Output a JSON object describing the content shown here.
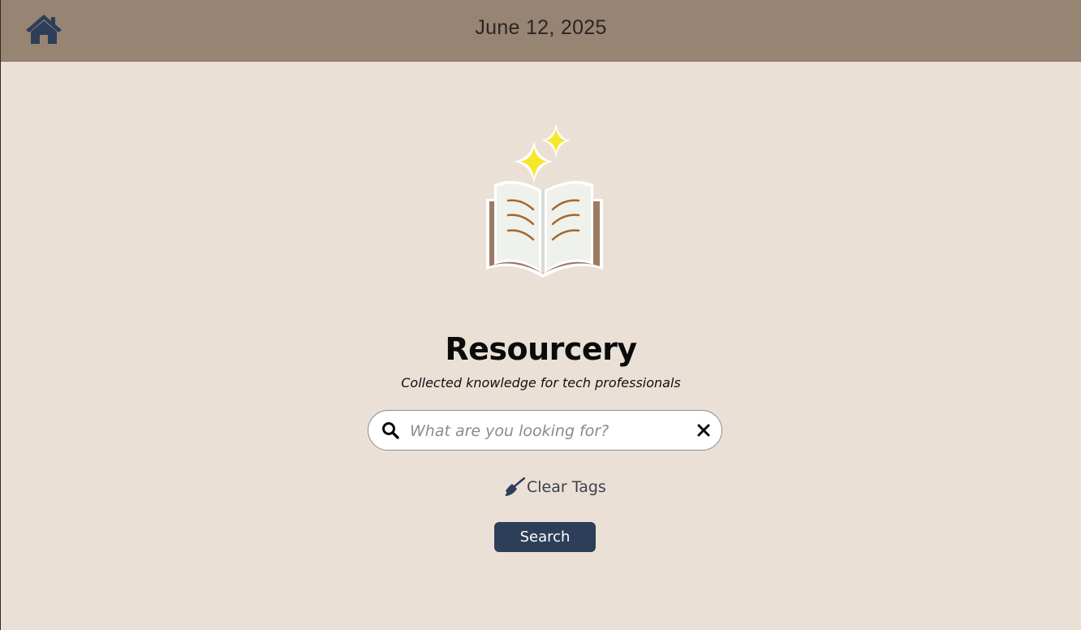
{
  "header": {
    "date": "June 12, 2025",
    "home_icon": "home-icon"
  },
  "hero": {
    "logo_icon": "open-book-sparkles-icon",
    "title": "Resourcery",
    "subtitle": "Collected knowledge for tech professionals"
  },
  "search": {
    "placeholder": "What are you looking for?",
    "value": "",
    "search_icon": "search-icon",
    "clear_icon": "close-icon"
  },
  "actions": {
    "clear_tags_label": "Clear Tags",
    "clear_tags_icon": "broom-icon",
    "search_label": "Search"
  },
  "colors": {
    "header_bg": "#988473",
    "page_bg": "#ebe0d6",
    "accent": "#2d3e58",
    "sparkle": "#f7e62a"
  }
}
